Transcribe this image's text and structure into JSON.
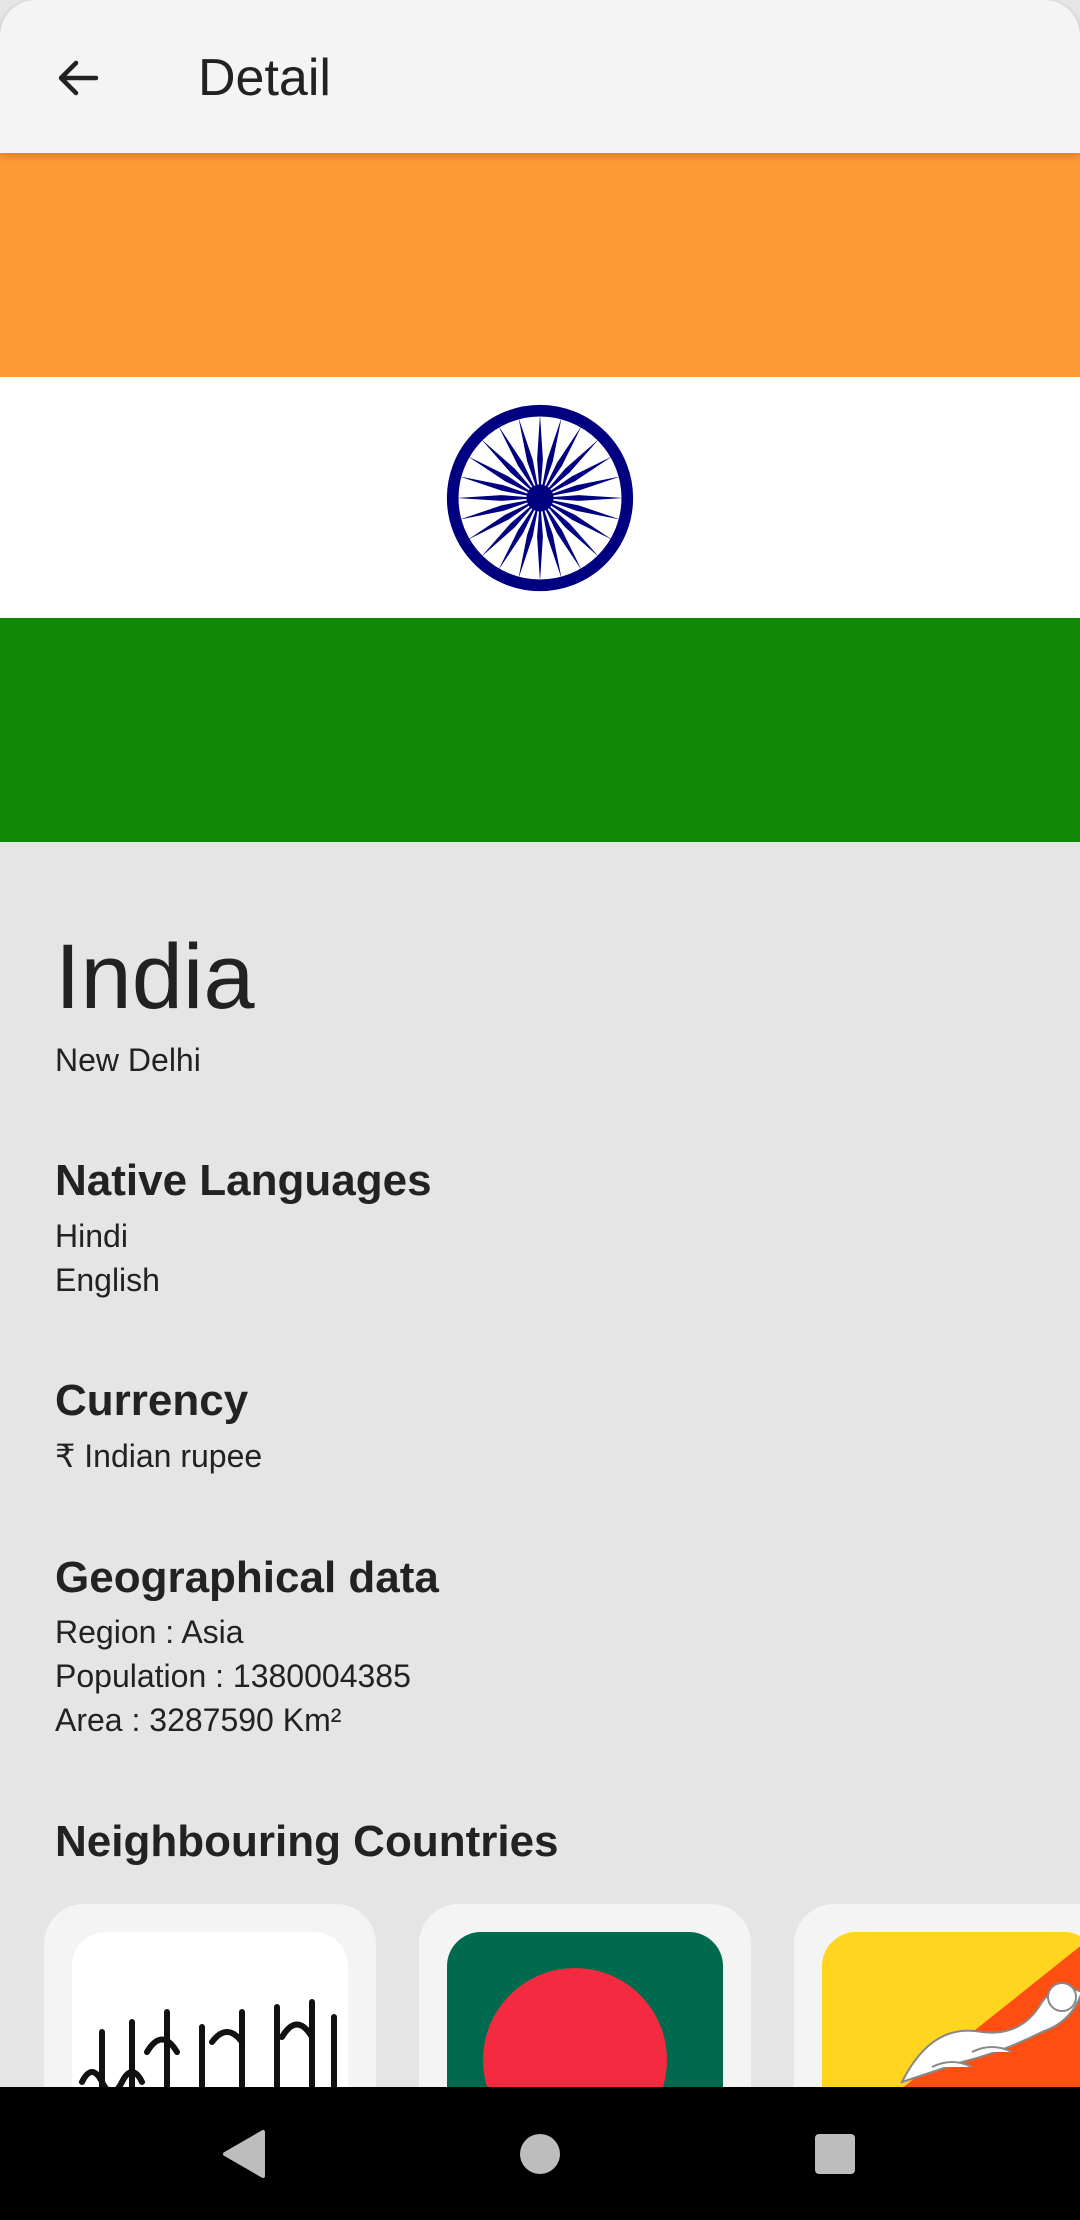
{
  "appbar": {
    "title": "Detail",
    "back_icon": "arrow-left-icon"
  },
  "flag": {
    "colors": {
      "top": "#ff9933",
      "middle": "#ffffff",
      "bottom": "#128807",
      "chakra": "#000080"
    }
  },
  "country": {
    "name": "India",
    "capital": "New Delhi"
  },
  "languages": {
    "title": "Native Languages",
    "items": [
      "Hindi",
      "English"
    ]
  },
  "currency": {
    "title": "Currency",
    "value": "₹ Indian rupee"
  },
  "geo": {
    "title": "Geographical data",
    "region": "Region : Asia",
    "population": "Population : 1380004385",
    "area": "Area : 3287590 Km²"
  },
  "neighbours": {
    "title": "Neighbouring Countries",
    "items": [
      {
        "flag": "afghanistan-flag"
      },
      {
        "flag": "bangladesh-flag"
      },
      {
        "flag": "bhutan-flag"
      }
    ]
  },
  "navbar": {
    "back": "nav-back-icon",
    "home": "nav-home-icon",
    "recents": "nav-recents-icon"
  }
}
